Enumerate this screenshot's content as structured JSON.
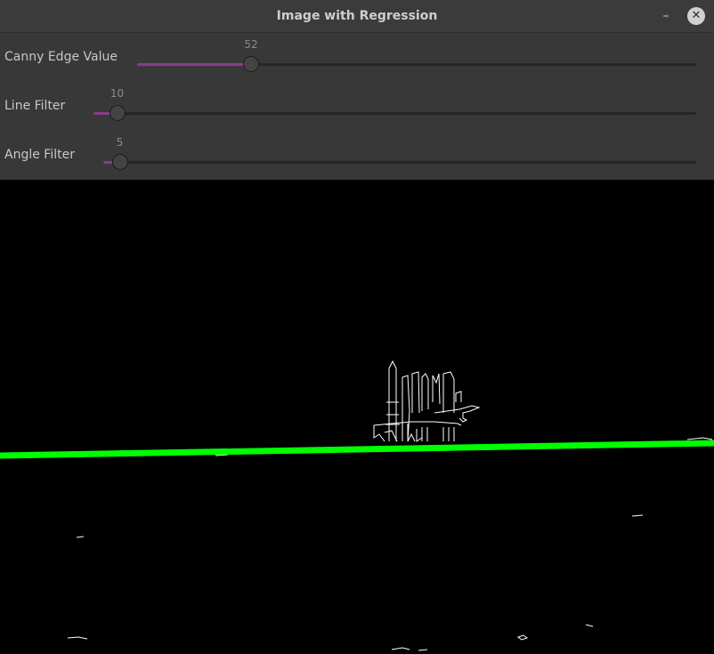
{
  "window": {
    "title": "Image with Regression"
  },
  "trackbars": [
    {
      "label": "Canny Edge Value",
      "value": "52",
      "max": 255
    },
    {
      "label": "Line Filter",
      "value": "10",
      "max": 255
    },
    {
      "label": "Angle Filter",
      "value": "5",
      "max": 180
    }
  ],
  "image": {
    "regression_line_color": "#00ff00",
    "edge_color": "#ffffff",
    "background_color": "#000000"
  },
  "colors": {
    "slider_fill": "#8a3c8a",
    "panel": "#383838",
    "titlebar": "#3b3b3b"
  }
}
